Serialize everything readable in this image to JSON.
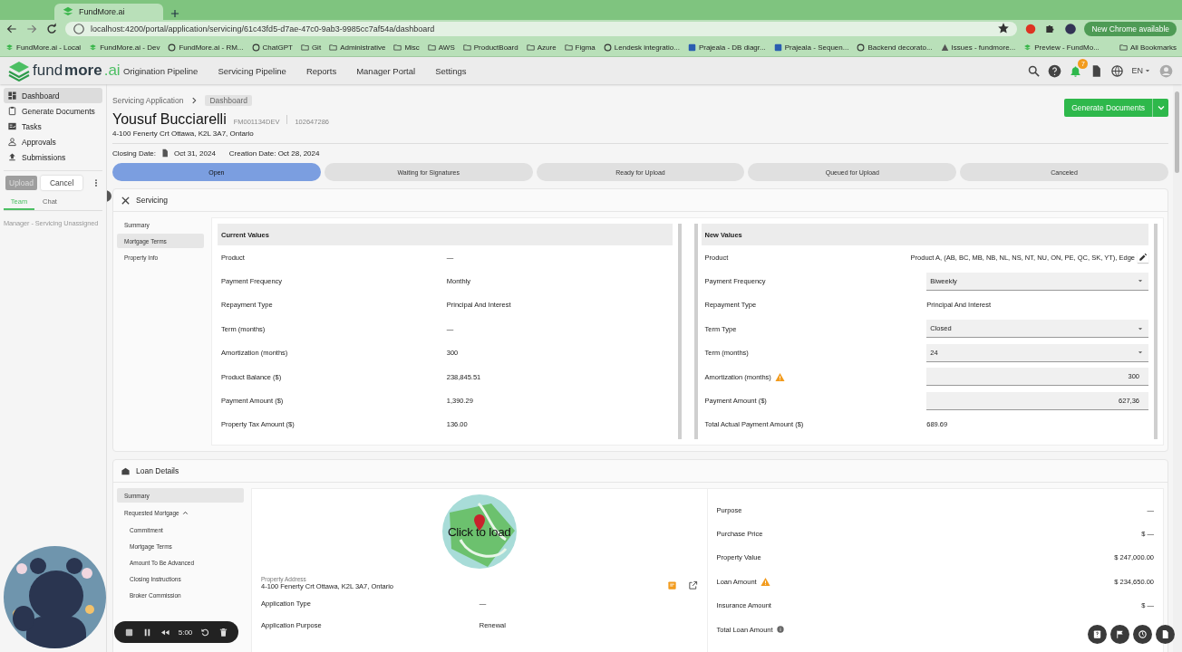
{
  "browser": {
    "tabs": [
      {
        "title": "FundMore.ai",
        "selected": true
      }
    ],
    "address": "localhost:4200/portal/application/servicing/61c43fd5-d7ae-47c0-9ab3-9985cc7af54a/dashboard",
    "update_button": "New Chrome available",
    "bookmarks": [
      {
        "label": "FundMore.ai - Local",
        "kind": "logo"
      },
      {
        "label": "FundMore.ai - Dev",
        "kind": "logo"
      },
      {
        "label": "FundMore.ai - RM...",
        "kind": "ring"
      },
      {
        "label": "ChatGPT",
        "kind": "ring"
      },
      {
        "label": "Git",
        "kind": "folder"
      },
      {
        "label": "Administrative",
        "kind": "folder"
      },
      {
        "label": "Misc",
        "kind": "folder"
      },
      {
        "label": "AWS",
        "kind": "folder"
      },
      {
        "label": "ProductBoard",
        "kind": "folder"
      },
      {
        "label": "Azure",
        "kind": "folder"
      },
      {
        "label": "Figma",
        "kind": "folder"
      },
      {
        "label": "Lendesk integratio...",
        "kind": "ring"
      },
      {
        "label": "Prajeala - DB diagr...",
        "kind": "square"
      },
      {
        "label": "Prajeala - Sequen...",
        "kind": "square"
      },
      {
        "label": "Backend decorato...",
        "kind": "ring"
      },
      {
        "label": "Issues - fundmore...",
        "kind": "triangle"
      },
      {
        "label": "Preview - FundMo...",
        "kind": "logo"
      }
    ],
    "all_bookmarks": "All Bookmarks"
  },
  "app": {
    "logo": {
      "plain": "fund",
      "bold": "more",
      "suffix": ".ai"
    },
    "nav": [
      "Origination Pipeline",
      "Servicing Pipeline",
      "Reports",
      "Manager Portal",
      "Settings"
    ],
    "notification_count": "7",
    "language": "EN"
  },
  "sidebar": {
    "items": [
      {
        "label": "Dashboard",
        "selected": true
      },
      {
        "label": "Generate Documents",
        "selected": false
      },
      {
        "label": "Tasks",
        "selected": false
      },
      {
        "label": "Approvals",
        "selected": false
      },
      {
        "label": "Submissions",
        "selected": false
      }
    ],
    "upload": {
      "label": "Upload",
      "disabled": true
    },
    "cancel": "Cancel",
    "tabs": [
      {
        "label": "Team",
        "selected": true
      },
      {
        "label": "Chat",
        "selected": false
      }
    ],
    "assignee": "Manager - Servicing Unassigned"
  },
  "breadcrumb": [
    "Servicing Application",
    "Dashboard"
  ],
  "applicant": {
    "name": "Yousuf Bucciarelli",
    "file_number": "FM001134DEV",
    "id": "102647286",
    "address": "4-100 Fenerty Crt Ottawa, K2L 3A7, Ontario"
  },
  "dates": {
    "closing_label": "Closing Date:",
    "closing_value": "Oct 31, 2024",
    "creation": "Creation Date: Oct 28, 2024"
  },
  "generate_button": "Generate Documents",
  "status_steps": [
    {
      "label": "Open",
      "selected": true
    },
    {
      "label": "Waiting for Signatures",
      "selected": false
    },
    {
      "label": "Ready for Upload",
      "selected": false
    },
    {
      "label": "Queued for Upload",
      "selected": false
    },
    {
      "label": "Canceled",
      "selected": false
    }
  ],
  "servicing": {
    "title": "Servicing",
    "nav": [
      {
        "label": "Summary",
        "selected": false
      },
      {
        "label": "Mortgage Terms",
        "selected": true
      },
      {
        "label": "Property Info",
        "selected": false
      }
    ],
    "current": {
      "title": "Current Values",
      "rows": [
        {
          "label": "Product",
          "value": "—"
        },
        {
          "label": "Payment Frequency",
          "value": "Monthly"
        },
        {
          "label": "Repayment Type",
          "value": "Principal And Interest"
        },
        {
          "label": "Term (months)",
          "value": "—"
        },
        {
          "label": "Amortization (months)",
          "value": "300"
        },
        {
          "label": "Product Balance ($)",
          "value": "238,845.51"
        },
        {
          "label": "Payment Amount ($)",
          "value": "1,390.29"
        },
        {
          "label": "Property Tax Amount ($)",
          "value": "136.00"
        }
      ]
    },
    "new": {
      "title": "New Values",
      "rows": [
        {
          "label": "Product",
          "value": "Product A, (AB, BC, MB, NB, NL, NS, NT, NU, ON, PE, QC, SK, YT), Edge",
          "kind": "edit",
          "warning": false
        },
        {
          "label": "Payment Frequency",
          "value": "Biweekly",
          "kind": "select",
          "warning": false
        },
        {
          "label": "Repayment Type",
          "value": "Principal And Interest",
          "kind": "text",
          "warning": false
        },
        {
          "label": "Term Type",
          "value": "Closed",
          "kind": "select",
          "warning": false
        },
        {
          "label": "Term (months)",
          "value": "24",
          "kind": "select",
          "warning": false
        },
        {
          "label": "Amortization (months)",
          "value": "300",
          "kind": "input",
          "warning": true
        },
        {
          "label": "Payment Amount ($)",
          "value": "627,36",
          "kind": "input",
          "warning": false
        },
        {
          "label": "Total Actual Payment Amount ($)",
          "value": "689.69",
          "kind": "text",
          "warning": false
        }
      ]
    }
  },
  "loan_details": {
    "title": "Loan Details",
    "nav": [
      {
        "label": "Summary",
        "selected": true
      },
      {
        "label": "Requested Mortgage",
        "selected": false,
        "expanded": true,
        "children": [
          {
            "label": "Commitment",
            "selected": false
          },
          {
            "label": "Mortgage Terms",
            "selected": false
          },
          {
            "label": "Amount To Be Advanced",
            "selected": false
          },
          {
            "label": "Closing Instructions",
            "selected": false
          },
          {
            "label": "Broker Commission",
            "selected": false
          }
        ]
      }
    ],
    "map": {
      "overlay": "Click to load"
    },
    "property_address": {
      "label": "Property Address",
      "value": "4-100 Fenerty Crt Ottawa, K2L 3A7, Ontario"
    },
    "left_rows": [
      {
        "label": "Application Type",
        "value": "—"
      },
      {
        "label": "Application Purpose",
        "value": "Renewal"
      }
    ],
    "right_rows": [
      {
        "label": "Purpose",
        "value": "—",
        "warning": false,
        "info": false
      },
      {
        "label": "Purchase Price",
        "value": "$ —",
        "warning": false,
        "info": false
      },
      {
        "label": "Property Value",
        "value": "$ 247,000.00",
        "warning": false,
        "info": false
      },
      {
        "label": "Loan Amount",
        "value": "$ 234,650.00",
        "warning": true,
        "info": false
      },
      {
        "label": "Insurance Amount",
        "value": "$ —",
        "warning": false,
        "info": false
      },
      {
        "label": "Total Loan Amount",
        "warning": false,
        "info": true
      }
    ]
  },
  "recorder": {
    "time": "5:00"
  }
}
